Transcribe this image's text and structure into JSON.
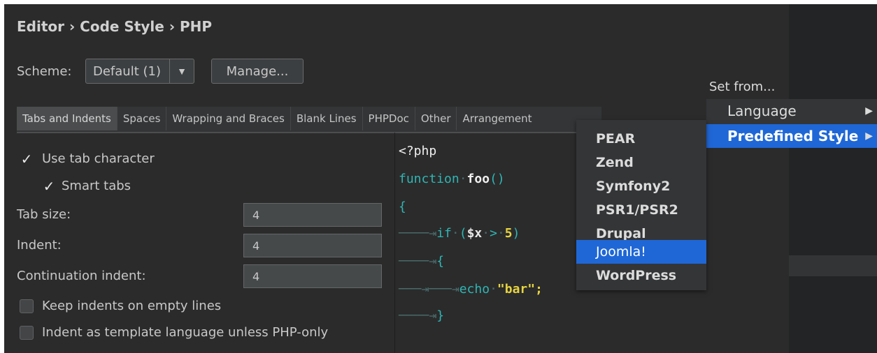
{
  "breadcrumb": "Editor › Code Style › PHP",
  "scheme": {
    "label": "Scheme:",
    "value": "Default (1)",
    "manage_label": "Manage..."
  },
  "tabs": [
    {
      "label": "Tabs and Indents",
      "active": true
    },
    {
      "label": "Spaces"
    },
    {
      "label": "Wrapping and Braces"
    },
    {
      "label": "Blank Lines"
    },
    {
      "label": "PHPDoc"
    },
    {
      "label": "Other"
    },
    {
      "label": "Arrangement"
    }
  ],
  "options": {
    "use_tab": {
      "label": "Use tab character",
      "checked": true
    },
    "smart_tabs": {
      "label": "Smart tabs",
      "checked": true
    },
    "tab_size": {
      "label": "Tab size:",
      "value": "4"
    },
    "indent": {
      "label": "Indent:",
      "value": "4"
    },
    "continuation": {
      "label": "Continuation indent:",
      "value": "4"
    },
    "keep_indents": {
      "label": "Keep indents on empty lines",
      "checked": false
    },
    "template_indent": {
      "label": "Indent as template language unless PHP-only",
      "checked": false
    }
  },
  "code": {
    "l1": "<?php",
    "l2_kw": "function",
    "l2_fn": "foo",
    "l2_paren": "()",
    "l3": "{",
    "l4_kw": "if",
    "l4_open": "(",
    "l4_var": "$x",
    "l4_op": ">",
    "l4_num": "5",
    "l4_close": ")",
    "l5": "{",
    "l6_kw": "echo",
    "l6_str": "\"bar\";",
    "l7": "}"
  },
  "set_from": {
    "label": "Set from...",
    "items": [
      {
        "label": "Language"
      },
      {
        "label": "Predefined Style",
        "selected": true
      }
    ],
    "submenu_arrow": "▶"
  },
  "predefined_styles": [
    {
      "label": "PEAR"
    },
    {
      "label": "Zend"
    },
    {
      "label": "Symfony2"
    },
    {
      "label": "PSR1/PSR2"
    },
    {
      "label": "Drupal"
    },
    {
      "label": "Joomla!",
      "selected": true
    },
    {
      "label": "WordPress"
    }
  ],
  "icons": {
    "checkmark": "✓",
    "dropdown": "▼",
    "tab_arrow": "→"
  },
  "colors": {
    "selection": "#1f67d6",
    "keyword": "#2fb5b4",
    "number": "#e6d341",
    "background": "#2b2b2b"
  }
}
